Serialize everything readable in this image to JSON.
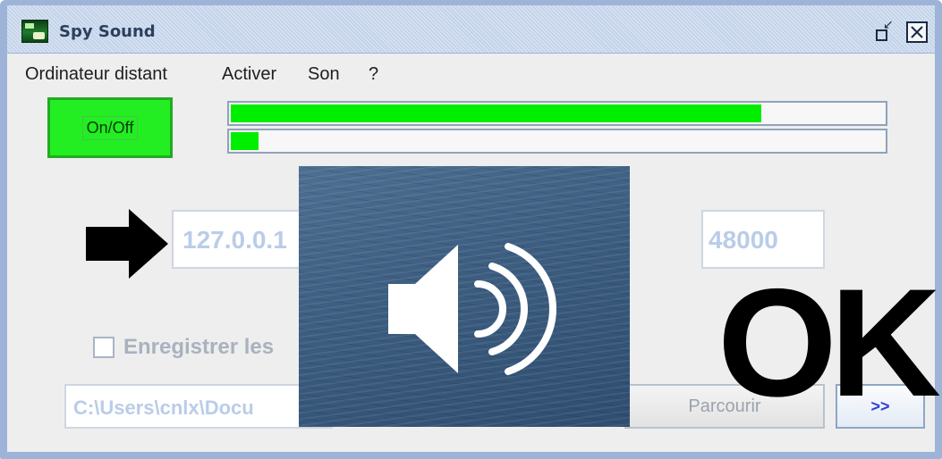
{
  "window": {
    "title": "Spy Sound",
    "restore_icon": "restore-window-icon",
    "close_icon": "close-window-icon"
  },
  "menu": {
    "items": [
      "Ordinateur distant",
      "Activer",
      "Son",
      "?"
    ]
  },
  "controls": {
    "onoff_label": "On/Off",
    "onoff_color": "#22ee22",
    "level_bars": [
      {
        "level_percent": 81
      },
      {
        "level_percent": 4.5
      }
    ],
    "level_color": "#00ee00",
    "arrow_icon": "arrow-right-icon",
    "ip_value": "127.0.0.1",
    "port_value": "48000",
    "record_label": "Enregistrer les",
    "record_checked": false,
    "path_value": "C:\\Users\\cnlx\\Docu",
    "browse_label": "Parcourir",
    "go_label": ">>"
  },
  "overlay": {
    "speaker_icon": "speaker-volume-icon",
    "ok_text": "OK"
  }
}
